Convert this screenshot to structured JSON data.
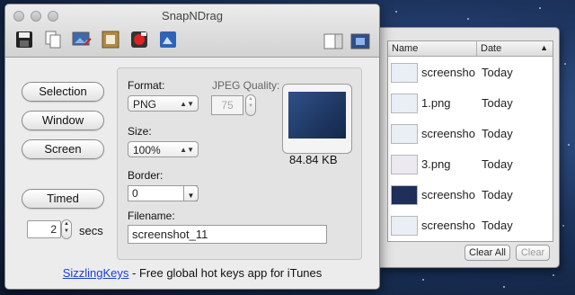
{
  "window": {
    "title": "SnapNDrag"
  },
  "toolbar": {
    "icons": [
      "save-icon",
      "copy-icon",
      "edit-image-icon",
      "frame-icon",
      "record-icon",
      "picture-icon"
    ],
    "right_icons": [
      "sidebar-toggle-icon",
      "screen-capture-icon"
    ]
  },
  "capture": {
    "selection_label": "Selection",
    "window_label": "Window",
    "screen_label": "Screen",
    "timed_label": "Timed",
    "timer_value": "2",
    "timer_unit": "secs"
  },
  "settings": {
    "format_label": "Format:",
    "format_value": "PNG",
    "jpeg_quality_label": "JPEG Quality:",
    "jpeg_quality_value": "75",
    "size_label": "Size:",
    "size_value": "100%",
    "border_label": "Border:",
    "border_value": "0",
    "filename_label": "Filename:",
    "filename_value": "screenshot_11",
    "file_size": "84.84 KB"
  },
  "footer": {
    "link_text": "SizzlingKeys",
    "text": " - Free global hot keys app for iTunes"
  },
  "history": {
    "col_name": "Name",
    "col_date": "Date",
    "rows": [
      {
        "name": "screensho",
        "date": "Today",
        "thumb": "#eaeef5"
      },
      {
        "name": "1.png",
        "date": "Today",
        "thumb": "#eaeef5"
      },
      {
        "name": "screensho",
        "date": "Today",
        "thumb": "#eaeef5"
      },
      {
        "name": "3.png",
        "date": "Today",
        "thumb": "#eceaf0"
      },
      {
        "name": "screensho",
        "date": "Today",
        "thumb": "#1d2f5a"
      },
      {
        "name": "screensho",
        "date": "Today",
        "thumb": "#eaeef5"
      }
    ],
    "clear_all_label": "Clear All",
    "clear_label": "Clear"
  }
}
